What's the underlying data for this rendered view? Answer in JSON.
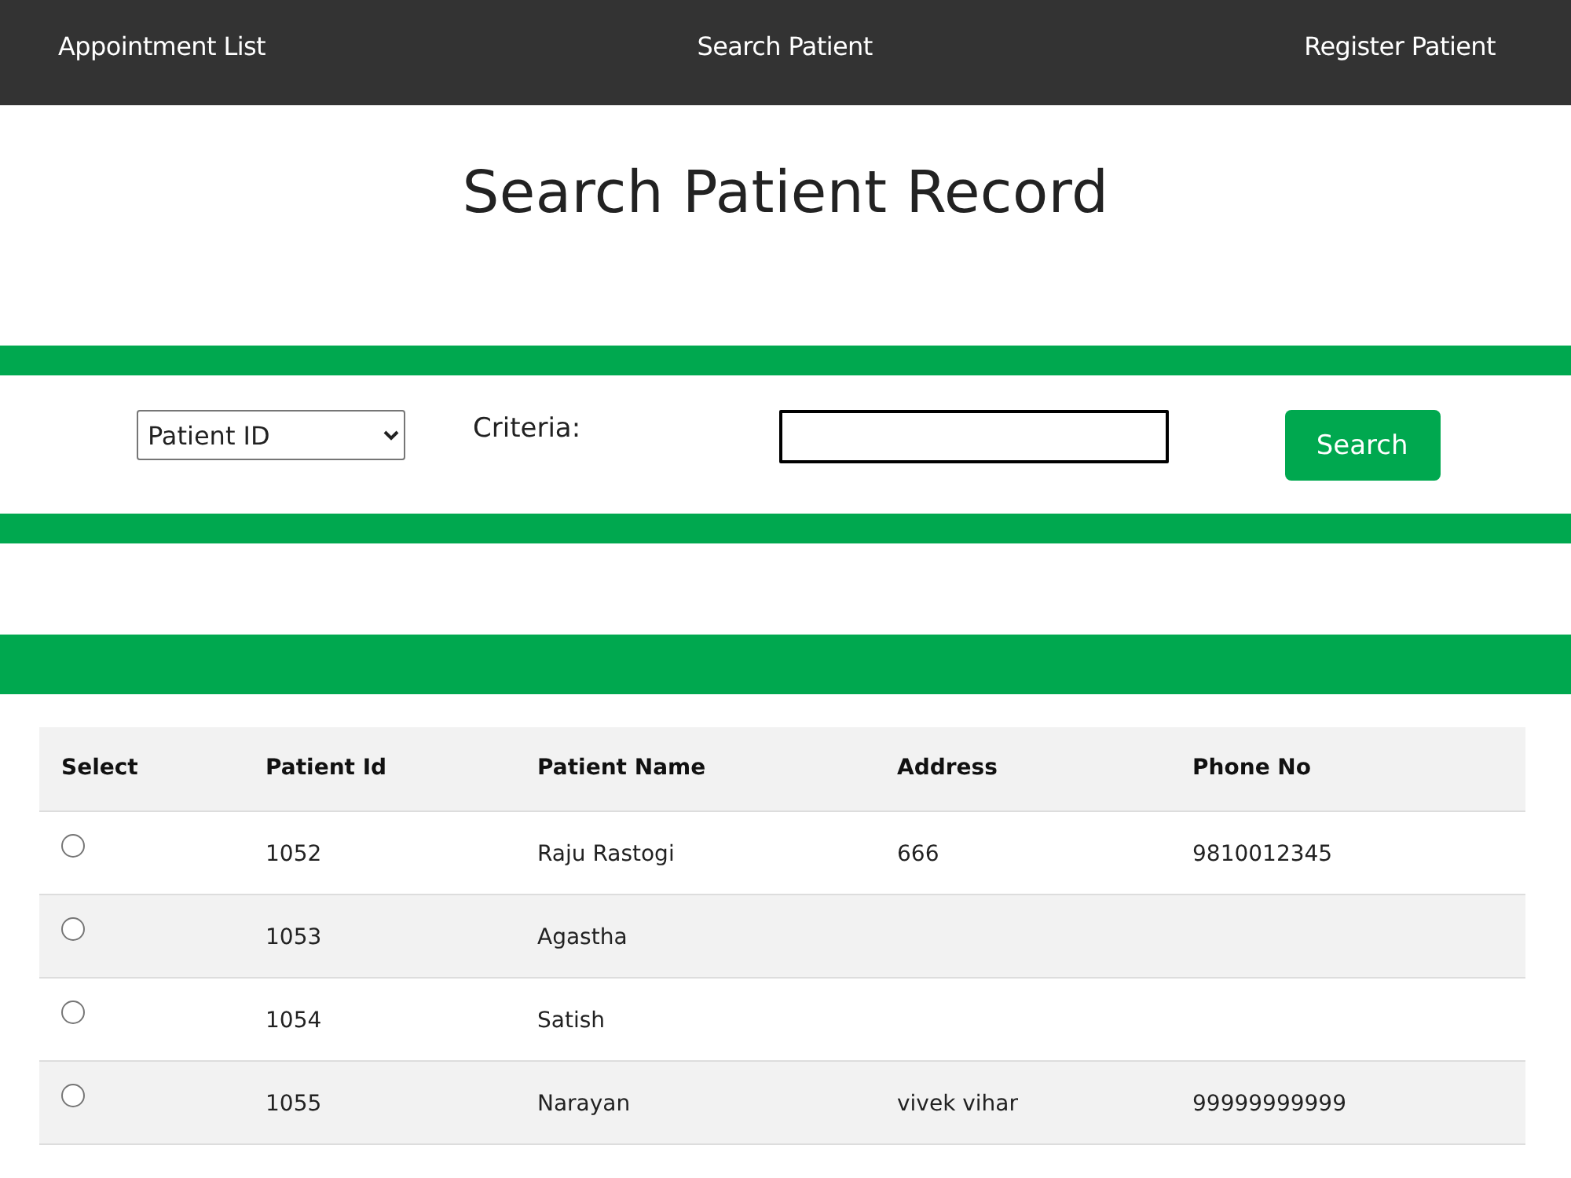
{
  "nav": {
    "items": [
      {
        "label": "Appointment List"
      },
      {
        "label": "Search Patient"
      },
      {
        "label": "Register Patient"
      }
    ]
  },
  "title": "Search Patient Record",
  "search": {
    "field_select": {
      "value": "Patient ID"
    },
    "criteria_label": "Criteria:",
    "button": "Search"
  },
  "table": {
    "columns": [
      "Select",
      "Patient Id",
      "Patient Name",
      "Address",
      "Phone No"
    ],
    "rows": [
      {
        "selected": false,
        "patient_id": "1052",
        "patient_name": "Raju Rastogi",
        "address": "666",
        "phone_no": "9810012345"
      },
      {
        "selected": false,
        "patient_id": "1053",
        "patient_name": "Agastha"
      },
      {
        "selected": false,
        "patient_id": "1054",
        "patient_name": "Satish"
      },
      {
        "selected": false,
        "patient_id": "1055",
        "patient_name": "Narayan",
        "address": "vivek vihar",
        "phone_no": "99999999999"
      }
    ]
  }
}
